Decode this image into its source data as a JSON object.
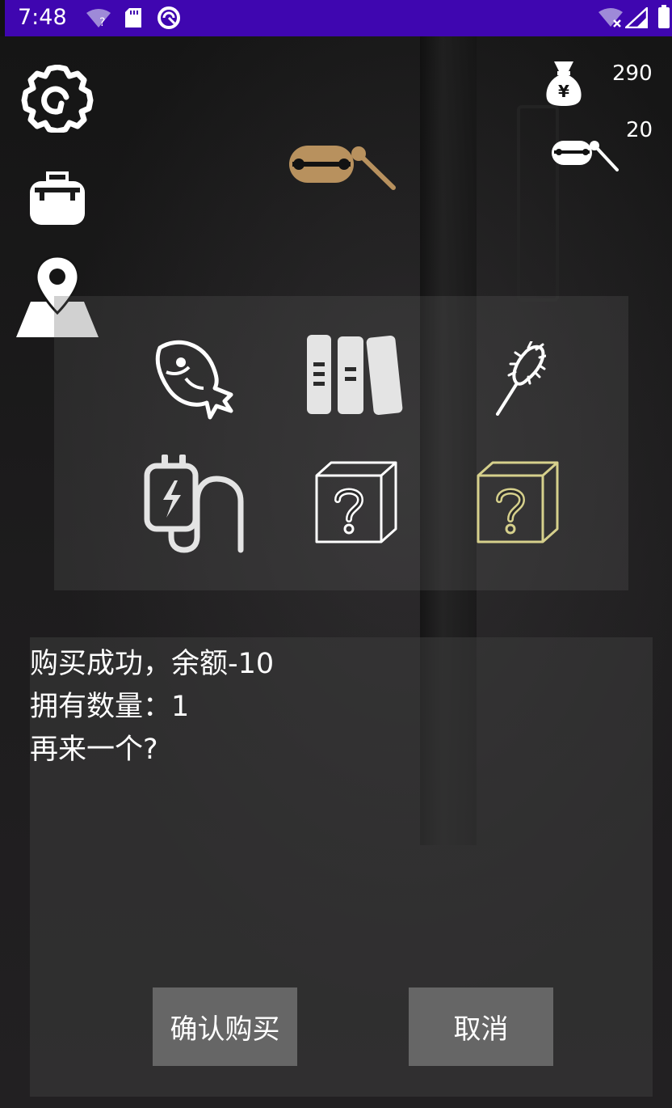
{
  "status_bar": {
    "time": "7:48",
    "icons": [
      "wifi-question-icon",
      "sd-card-icon",
      "sync-circle-icon",
      "wifi-x-icon",
      "signal-icon",
      "battery-icon"
    ]
  },
  "side_menu": {
    "icons": [
      "settings-gear-icon",
      "backpack-icon",
      "map-pin-icon"
    ]
  },
  "currency": {
    "money_icon": "money-bag-icon",
    "money_value": "290",
    "token_icon": "key-token-icon",
    "token_value": "20"
  },
  "center_item_icon": "key-token-icon",
  "shop_items": [
    "fish-icon",
    "books-icon",
    "brush-icon",
    "charger-icon",
    "mystery-box-icon",
    "mystery-box-gold-icon"
  ],
  "message": {
    "line1": "购买成功，余额-10",
    "line2": "拥有数量：1",
    "line3": "再来一个?"
  },
  "buttons": {
    "confirm": "确认购买",
    "cancel": "取消"
  },
  "colors": {
    "status_bar": "#3f06b0",
    "button_bg": "#666666",
    "key_gold": "#b8915e",
    "mystery_gold": "#d6d08c"
  }
}
